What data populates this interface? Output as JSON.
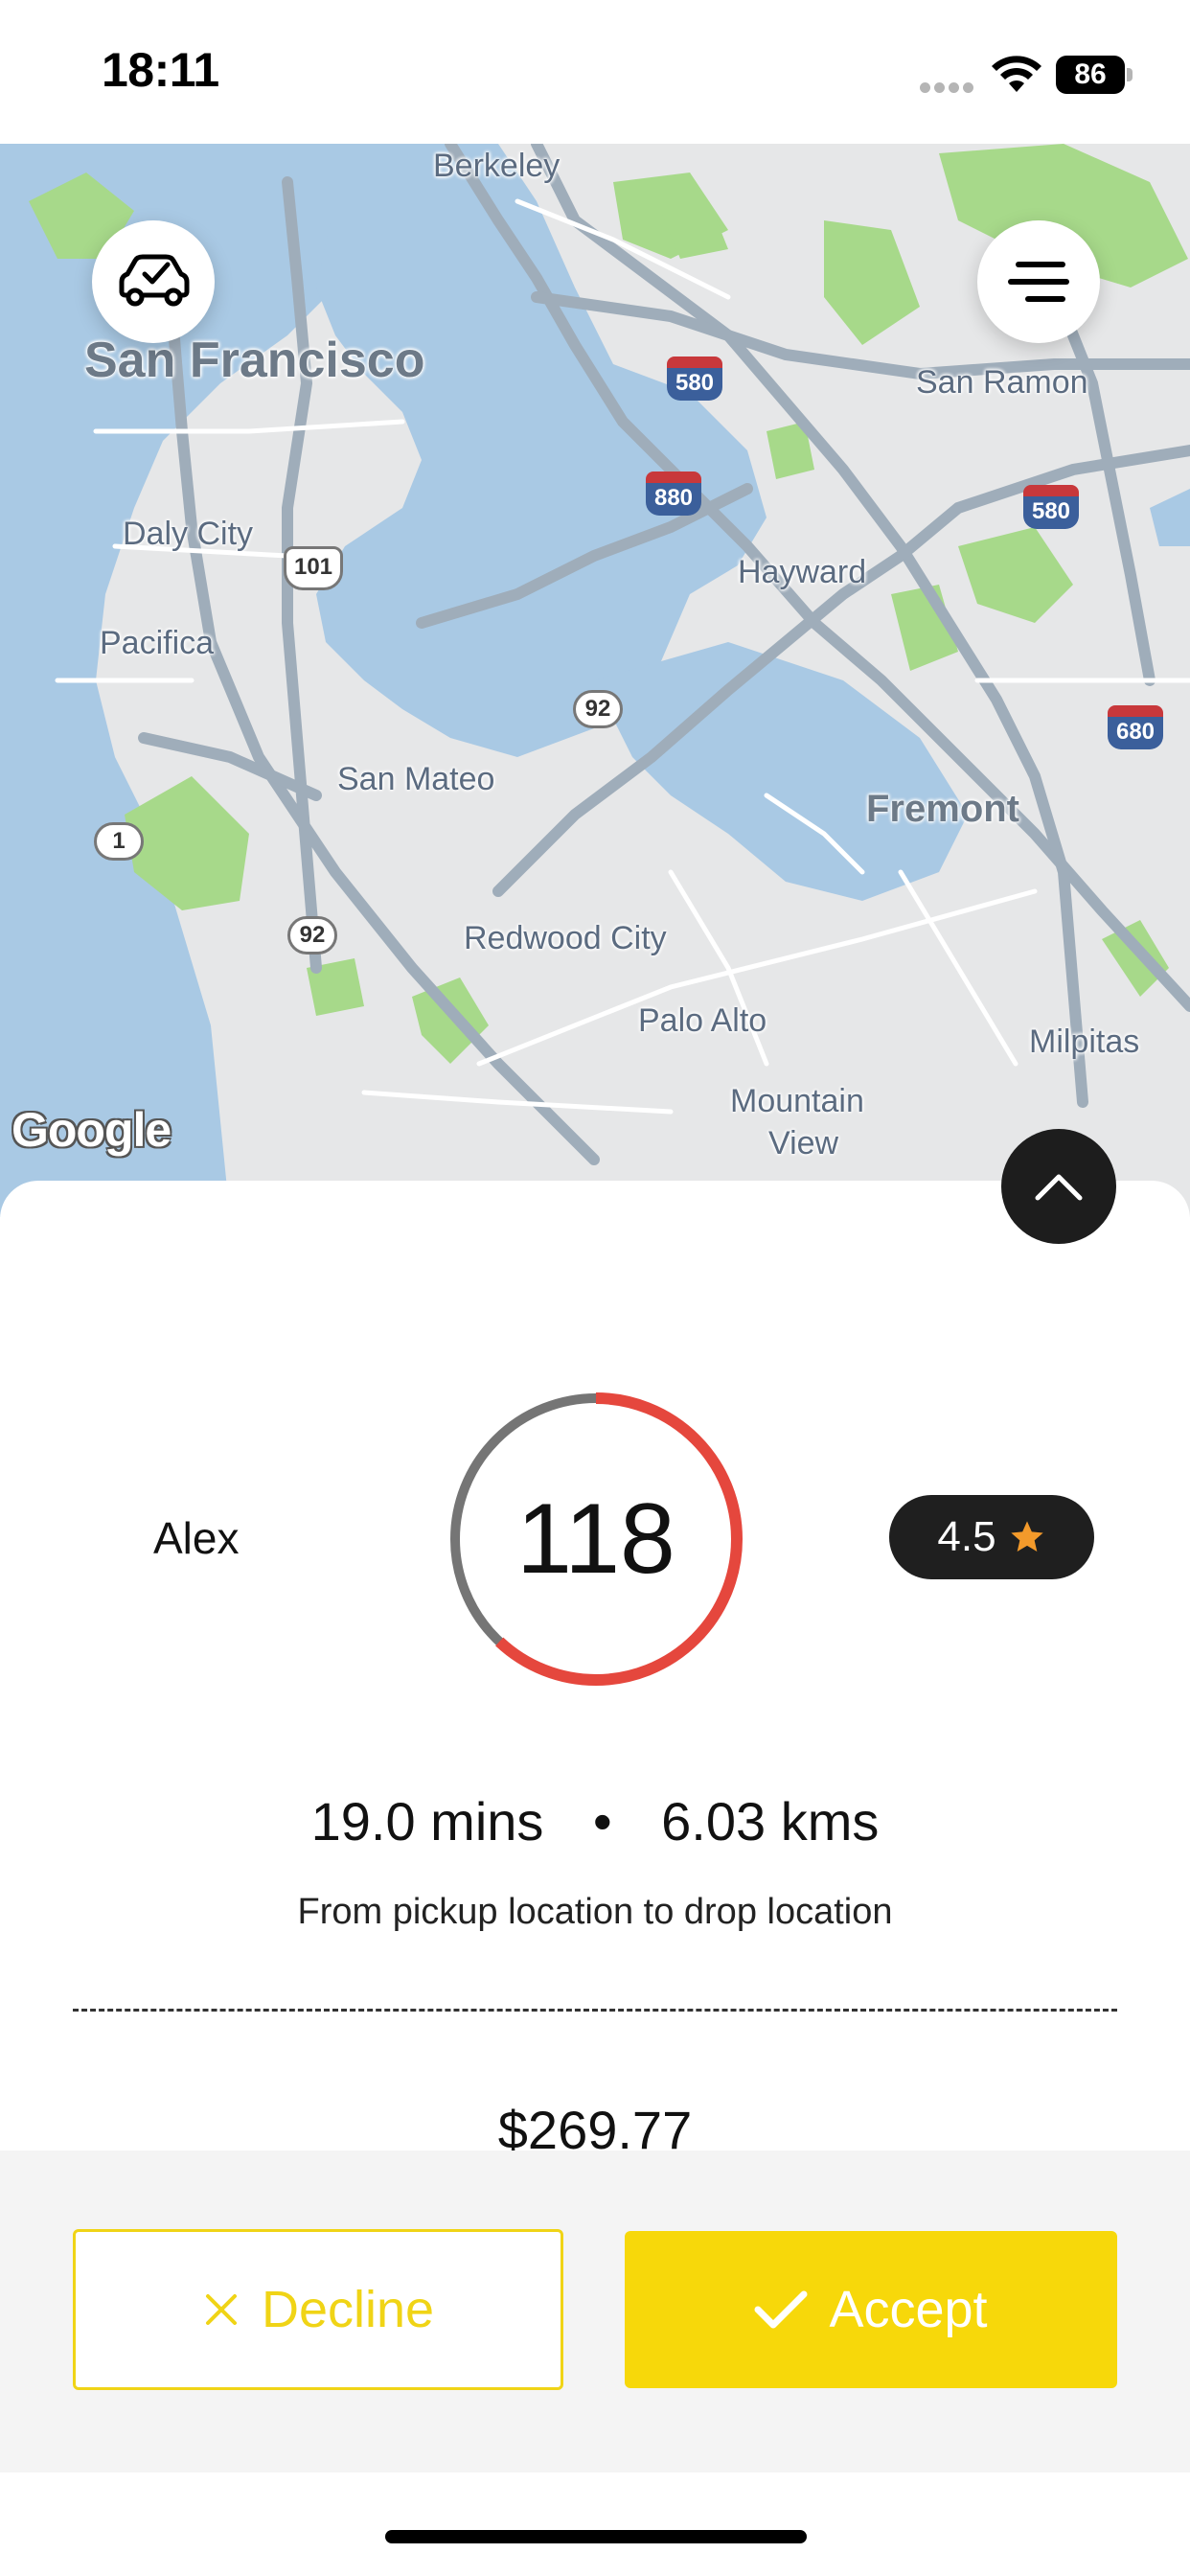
{
  "status_bar": {
    "time": "18:11",
    "battery": "86"
  },
  "map": {
    "attribution": "Google",
    "labels": {
      "berkeley": "Berkeley",
      "san_francisco": "San Francisco",
      "san_ramon": "San Ramon",
      "daly_city": "Daly City",
      "hayward": "Hayward",
      "pacifica": "Pacifica",
      "san_mateo": "San Mateo",
      "fremont": "Fremont",
      "redwood_city": "Redwood City",
      "palo_alto": "Palo Alto",
      "milpitas": "Milpitas",
      "mountain_view_1": "Mountain",
      "mountain_view_2": "View"
    },
    "shields": {
      "i580_a": "580",
      "i880": "880",
      "i580_b": "580",
      "i680": "680",
      "us101": "101",
      "ca92_a": "92",
      "ca92_b": "92",
      "ca1": "1"
    }
  },
  "request": {
    "rider_name": "Alex",
    "score": "118",
    "score_progress": 0.62,
    "rating": "4.5",
    "duration": "19.0 mins",
    "separator": "•",
    "distance": "6.03 kms",
    "route_description": "From pickup location to drop location",
    "fare": "$269.77"
  },
  "actions": {
    "decline_label": "Decline",
    "accept_label": "Accept"
  },
  "colors": {
    "accent_yellow": "#f7d80a",
    "ring_red": "#e5473d",
    "ring_gray": "#757575",
    "star_orange": "#f39a2b"
  }
}
